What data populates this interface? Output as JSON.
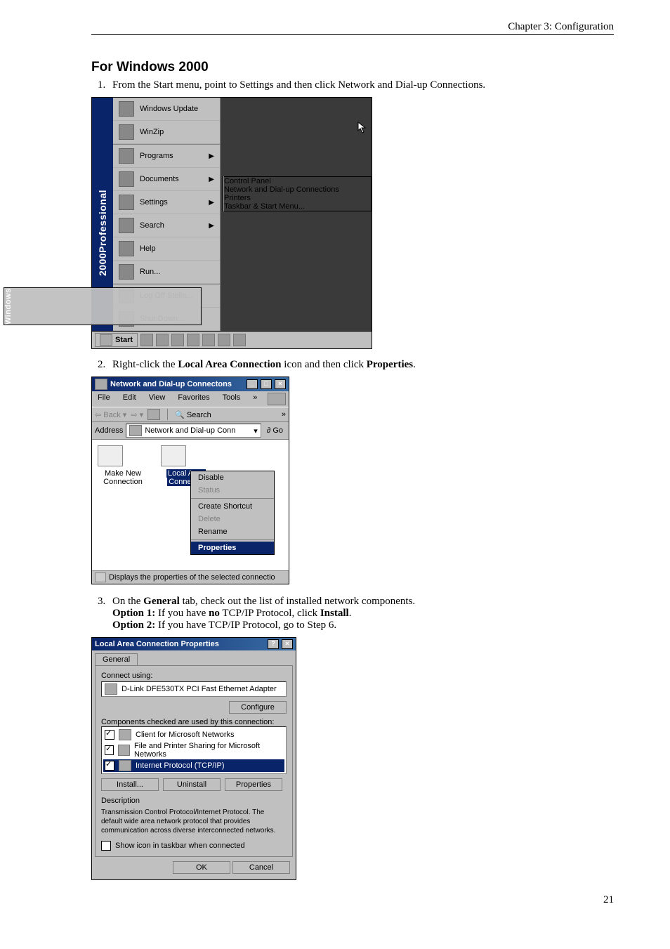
{
  "header": "Chapter 3: Configuration",
  "section_title": "For Windows 2000",
  "steps": {
    "s1": "From the Start menu, point to Settings and then click Network and Dial-up Connections.",
    "s2_pre": "Right-click the ",
    "s2_b1": "Local Area Connection",
    "s2_mid": " icon and then click ",
    "s2_b2": "Properties",
    "s2_post": ".",
    "s3_pre": "On the ",
    "s3_b1": "General",
    "s3_mid": " tab, check out the list of installed network components.",
    "s3_opt1_a": "Option 1:",
    "s3_opt1_b": " If you have ",
    "s3_opt1_c": "no",
    "s3_opt1_d": " TCP/IP Protocol, click ",
    "s3_opt1_e": "Install",
    "s3_opt1_f": ".",
    "s3_opt2_a": "Option 2:",
    "s3_opt2_b": " If you have TCP/IP Protocol, go to Step 6."
  },
  "startmenu": {
    "side_a": "Windows",
    "side_b": " 2000 ",
    "side_c": "Professional",
    "items": [
      "Windows Update",
      "WinZip",
      "Programs",
      "Documents",
      "Settings",
      "Search",
      "Help",
      "Run...",
      "Log Off Stella...",
      "Shut Down..."
    ],
    "settings_sub": [
      "Control Panel",
      "Network and Dial-up Connections",
      "Printers",
      "Taskbar & Start Menu..."
    ],
    "start_label": "Start"
  },
  "netwin": {
    "title": "Network and Dial-up Connectons",
    "menus": [
      "File",
      "Edit",
      "View",
      "Favorites",
      "Tools"
    ],
    "back": "Back",
    "search": "Search",
    "addr_label": "Address",
    "addr_value": "Network and Dial-up Conn",
    "go": "Go",
    "conn1a": "Make New",
    "conn1b": "Connection",
    "conn2a": "Local Area",
    "conn2b": "Connectio",
    "ctx": [
      "Disable",
      "Status",
      "Create Shortcut",
      "Delete",
      "Rename",
      "Properties"
    ],
    "status": "Displays the properties of the selected connectio"
  },
  "dlg": {
    "title": "Local Area Connection Properties",
    "tab": "General",
    "connect_using": "Connect using:",
    "adapter": "D-Link DFE530TX PCI Fast Ethernet Adapter",
    "configure": "Configure",
    "components_lbl": "Components checked are used by this connection:",
    "comp1": "Client for Microsoft Networks",
    "comp2": "File and Printer Sharing for Microsoft Networks",
    "comp3": "Internet Protocol (TCP/IP)",
    "install": "Install...",
    "uninstall": "Uninstall",
    "properties": "Properties",
    "desc_lbl": "Description",
    "desc_txt": "Transmission Control Protocol/Internet Protocol. The default wide area network protocol that provides communication across diverse interconnected networks.",
    "show_icon": "Show icon in taskbar when connected",
    "ok": "OK",
    "cancel": "Cancel"
  },
  "page_number": "21"
}
